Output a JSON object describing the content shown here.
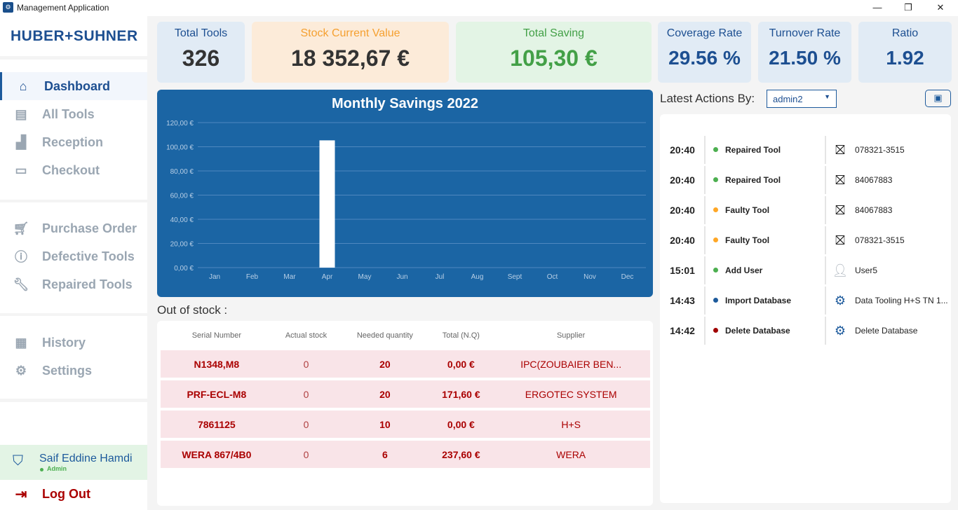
{
  "window": {
    "title": "Management Application",
    "minimize": "—",
    "maximize": "❐",
    "close": "✕"
  },
  "sidebar": {
    "logo": "HUBER+SUHNER",
    "items": [
      {
        "label": "Dashboard",
        "icon": "home-icon"
      },
      {
        "label": "All Tools",
        "icon": "clipboard-list-icon"
      },
      {
        "label": "Reception",
        "icon": "reception-icon"
      },
      {
        "label": "Checkout",
        "icon": "checkout-icon"
      },
      {
        "label": "Purchase Order",
        "icon": "cart-icon"
      },
      {
        "label": "Defective Tools",
        "icon": "alert-icon"
      },
      {
        "label": "Repaired Tools",
        "icon": "wrench-clock-icon"
      },
      {
        "label": "History",
        "icon": "calendar-history-icon"
      },
      {
        "label": "Settings",
        "icon": "gear-icon"
      }
    ],
    "user": {
      "name": "Saif Eddine Hamdi",
      "role": "Admin"
    },
    "logout": "Log Out"
  },
  "stats": [
    {
      "label": "Total Tools",
      "value": "326"
    },
    {
      "label": "Stock Current Value",
      "value": "18 352,67 €"
    },
    {
      "label": "Total Saving",
      "value": "105,30 €"
    },
    {
      "label": "Coverage Rate",
      "value": "29.56 %"
    },
    {
      "label": "Turnover Rate",
      "value": "21.50 %"
    },
    {
      "label": "Ratio",
      "value": "1.92"
    }
  ],
  "chart_data": {
    "type": "bar",
    "title": "Monthly Savings 2022",
    "categories": [
      "Jan",
      "Feb",
      "Mar",
      "Apr",
      "May",
      "Jun",
      "Jul",
      "Aug",
      "Sept",
      "Oct",
      "Nov",
      "Dec"
    ],
    "values": [
      0,
      0,
      0,
      105.3,
      0,
      0,
      0,
      0,
      0,
      0,
      0,
      0
    ],
    "yticks": [
      "0,00 €",
      "20,00 €",
      "40,00 €",
      "60,00 €",
      "80,00 €",
      "100,00 €",
      "120,00 €"
    ],
    "ylim": [
      0,
      120
    ],
    "xlabel": "",
    "ylabel": "",
    "bar_color": "#ffffff",
    "grid": true
  },
  "out_of_stock": {
    "title": "Out of stock :",
    "columns": [
      "Serial Number",
      "Actual stock",
      "Needed quantity",
      "Total (N.Q)",
      "Supplier"
    ],
    "rows": [
      [
        "N1348,M8",
        "0",
        "20",
        "0,00 €",
        "IPC(ZOUBAIER BEN..."
      ],
      [
        "PRF-ECL-M8",
        "0",
        "20",
        "171,60 €",
        "ERGOTEC SYSTEM"
      ],
      [
        "7861125",
        "0",
        "10",
        "0,00 €",
        "H+S"
      ],
      [
        "WERA 867/4B0",
        "0",
        "6",
        "237,60 €",
        "WERA"
      ]
    ]
  },
  "actions": {
    "label": "Latest Actions By:",
    "user": "admin2",
    "items": [
      {
        "time": "20:40",
        "action": "Repaired Tool",
        "color": "#4caf50",
        "icon": "no-image-icon",
        "target": "078321-3515"
      },
      {
        "time": "20:40",
        "action": "Repaired Tool",
        "color": "#4caf50",
        "icon": "no-image-icon",
        "target": "84067883"
      },
      {
        "time": "20:40",
        "action": "Faulty Tool",
        "color": "#ffa726",
        "icon": "no-image-icon",
        "target": "84067883"
      },
      {
        "time": "20:40",
        "action": "Faulty Tool",
        "color": "#ffa726",
        "icon": "no-image-icon",
        "target": "078321-3515"
      },
      {
        "time": "15:01",
        "action": "Add User",
        "color": "#4caf50",
        "icon": "user-lock-icon",
        "target": "User5"
      },
      {
        "time": "14:43",
        "action": "Import Database",
        "color": "#1d5a9c",
        "icon": "gear-icon",
        "target": "Data Tooling H+S TN 1..."
      },
      {
        "time": "14:42",
        "action": "Delete Database",
        "color": "#a00000",
        "icon": "gear-icon",
        "target": "Delete Database"
      }
    ]
  }
}
